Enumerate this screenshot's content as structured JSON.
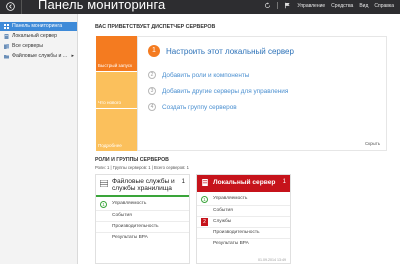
{
  "header": {
    "title": "Панель мониторинга",
    "menu": [
      "Управление",
      "Средства",
      "Вид",
      "Справка"
    ]
  },
  "sidebar": {
    "items": [
      {
        "label": "Панель мониторинга",
        "icon": "grid-icon",
        "active": true
      },
      {
        "label": "Локальный сервер",
        "icon": "server-icon",
        "active": false
      },
      {
        "label": "Все серверы",
        "icon": "servers-icon",
        "active": false
      },
      {
        "label": "Файловые службы и ...",
        "icon": "folder-icon",
        "active": false,
        "arrow": "▸"
      }
    ]
  },
  "welcome": {
    "title": "ВАС ПРИВЕТСТВУЕТ ДИСПЕТЧЕР СЕРВЕРОВ",
    "blocks": [
      "Быстрый запуск",
      "Что нового",
      "Подробнее"
    ],
    "steps": [
      {
        "num": "1",
        "label": "Настроить этот локальный сервер"
      },
      {
        "num": "2",
        "label": "Добавить роли и компоненты"
      },
      {
        "num": "3",
        "label": "Добавить другие серверы для управления"
      },
      {
        "num": "4",
        "label": "Создать группу серверов"
      }
    ],
    "hide": "Скрыть"
  },
  "roles": {
    "title": "РОЛИ И ГРУППЫ СЕРВЕРОВ",
    "subtitle": "Роли: 1 | Группы серверов: 1 | Всего серверов: 1"
  },
  "tiles": [
    {
      "name": "Файловые службы и службы хранилища",
      "count": "1",
      "icon": "storage-icon",
      "rows": [
        {
          "label": "Управляемость",
          "badge": "1"
        },
        {
          "label": "События"
        },
        {
          "label": "Производительность"
        },
        {
          "label": "Результаты BPA"
        }
      ]
    },
    {
      "name": "Локальный сервер",
      "count": "1",
      "icon": "server-icon",
      "rows": [
        {
          "label": "Управляемость",
          "badge": "1"
        },
        {
          "label": "События"
        },
        {
          "label": "Службы",
          "badge": "2"
        },
        {
          "label": "Производительность"
        },
        {
          "label": "Результаты BPA"
        }
      ],
      "timestamp": "01.09.2014 13:49"
    }
  ],
  "colors": {
    "header_bg": "#2d2d30",
    "accent_orange": "#f47b20",
    "accent_yellow": "#fbc05c",
    "link_blue": "#4a8fd0",
    "active_blue": "#3e8ad8",
    "status_green": "#3aa53a",
    "status_red": "#c6131b"
  }
}
